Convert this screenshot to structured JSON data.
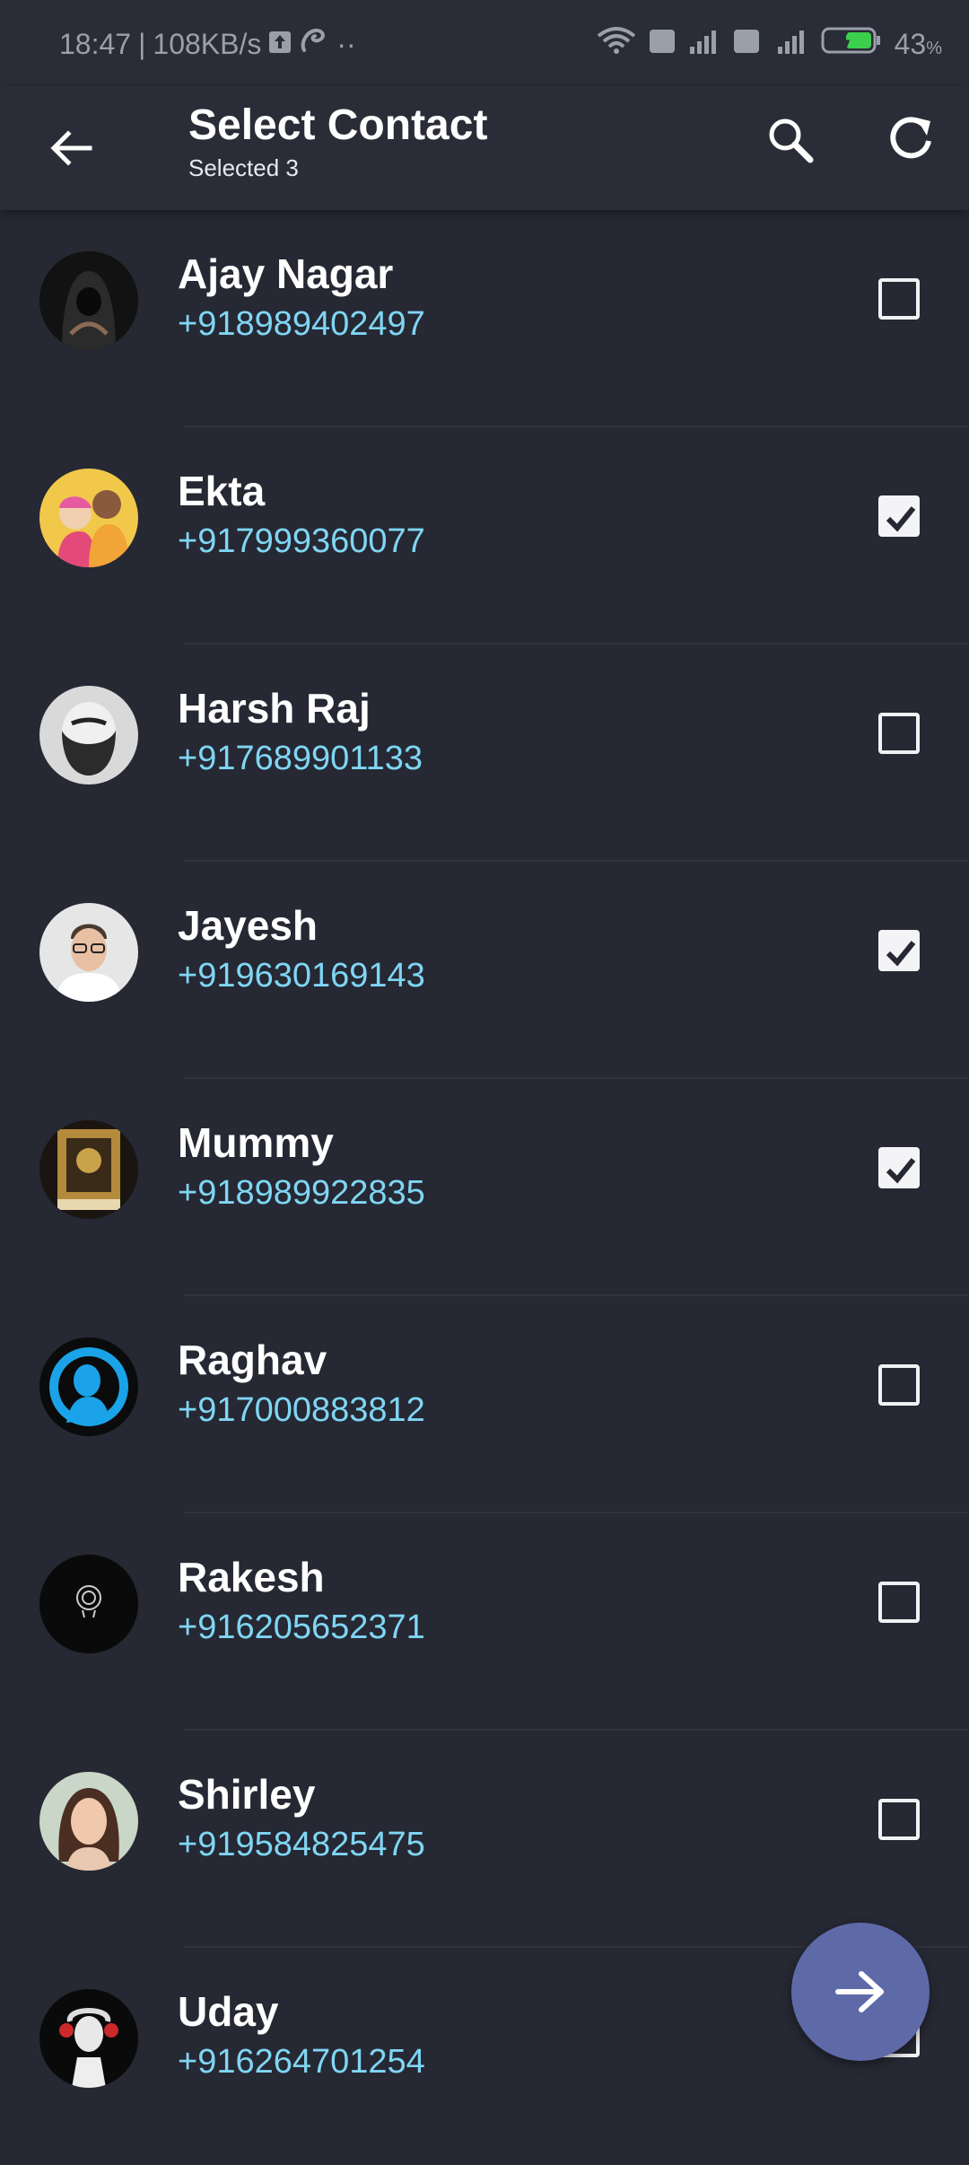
{
  "status": {
    "time": "18:47",
    "speed": "108KB/s",
    "battery": "43",
    "battery_unit": "%"
  },
  "header": {
    "title": "Select Contact",
    "subtitle": "Selected 3",
    "icons": [
      "arrow-back-icon",
      "search-icon",
      "refresh-icon"
    ]
  },
  "contacts": [
    {
      "name": "Ajay Nagar",
      "phone": "+918989402497",
      "checked": false
    },
    {
      "name": "Ekta",
      "phone": "+917999360077",
      "checked": true
    },
    {
      "name": "Harsh Raj",
      "phone": "+917689901133",
      "checked": false
    },
    {
      "name": "Jayesh",
      "phone": "+919630169143",
      "checked": true
    },
    {
      "name": "Mummy",
      "phone": "+918989922835",
      "checked": true
    },
    {
      "name": "Raghav",
      "phone": "+917000883812",
      "checked": false
    },
    {
      "name": "Rakesh",
      "phone": "+916205652371",
      "checked": false
    },
    {
      "name": "Shirley",
      "phone": "+919584825475",
      "checked": false
    },
    {
      "name": "Uday",
      "phone": "+916264701254",
      "checked": false
    }
  ],
  "fab_icon": "arrow-forward-icon",
  "colors": {
    "background": "#262833",
    "appbar": "#2a2c37",
    "phone_text": "#7fd6f3",
    "fab": "#5e6aa8"
  }
}
